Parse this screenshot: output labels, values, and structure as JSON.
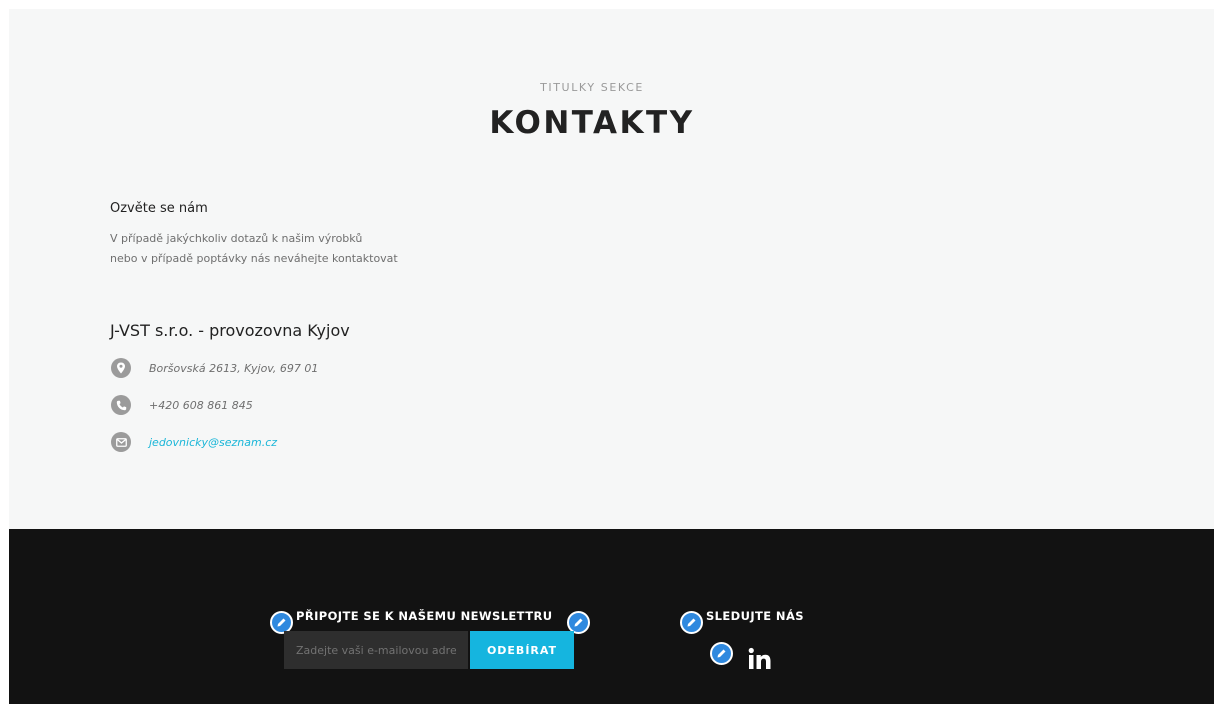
{
  "contact_section": {
    "subtitle": "TITULKY SEKCE",
    "title": "KONTAKTY",
    "intro_heading": "Ozvěte se nám",
    "intro_lines": [
      "V případě jakýchkoliv dotazů k našim výrobků",
      "nebo v případě poptávky nás neváhejte kontaktovat"
    ],
    "company_name": "J-VST s.r.o. - provozovna Kyjov",
    "address": "Boršovská 2613, Kyjov, 697 01",
    "phone": "+420 608 861 845",
    "email": "jedovnicky@seznam.cz"
  },
  "footer": {
    "newsletter_heading": "PŘIPOJTE SE K NAŠEMU NEWSLETTRU",
    "email_placeholder": "Zadejte vaši e-mailovou adresu",
    "subscribe_label": "ODEBÍRAT",
    "follow_heading": "SLEDUJTE NÁS",
    "social_icon": "linkedin-icon"
  },
  "colors": {
    "accent": "#15b5df",
    "edit_icon": "#2f89df",
    "footer_background": "#121212",
    "section_background": "#f6f7f7"
  }
}
